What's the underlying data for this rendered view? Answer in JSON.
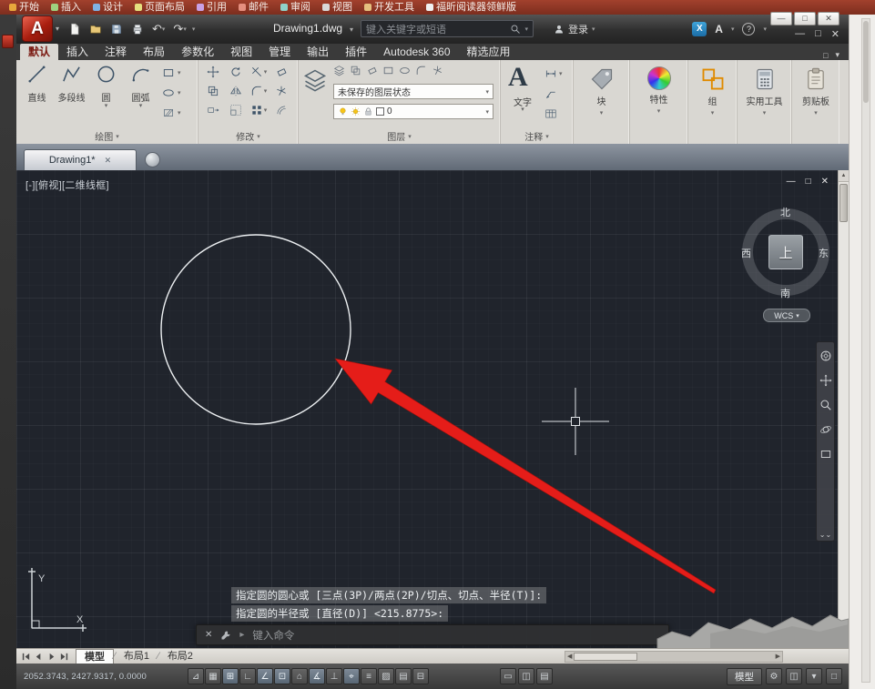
{
  "icons": {
    "minimize": "—",
    "restore": "□",
    "close": "✕",
    "dropdown": "▾",
    "caret": "▸",
    "undo": "↶",
    "redo": "↷",
    "up": "▲",
    "down": "▼",
    "left": "◀",
    "right": "▶",
    "infer": "⊿",
    "snap": "▦",
    "grid": "⊞",
    "ortho": "∟",
    "polar": "∠",
    "osnap": "⊡",
    "osnap3d": "⌂",
    "otrack": "∡",
    "ducs": "⊥",
    "dyn": "⌖",
    "lwt": "≡",
    "transparency": "▨",
    "qp": "▤",
    "cycling": "⊟",
    "slash": "∕",
    "question": "?",
    "exchange": "X",
    "autodesk_a": "A",
    "rect": "▭",
    "split": "◫",
    "gear": "⚙",
    "chevrons": "⌄⌄"
  },
  "outer": {
    "menubar": {
      "items": [
        "开始",
        "插入",
        "设计",
        "页面布局",
        "引用",
        "邮件",
        "审阅",
        "视图",
        "开发工具",
        "福昕阅读器领鲜版"
      ]
    }
  },
  "titlebar": {
    "logo_letter": "A",
    "title": "Drawing1.dwg",
    "search_placeholder": "键入关键字或短语",
    "signin_label": "登录"
  },
  "ribbon": {
    "tabs": [
      {
        "label": "默认"
      },
      {
        "label": "插入"
      },
      {
        "label": "注释"
      },
      {
        "label": "布局"
      },
      {
        "label": "参数化"
      },
      {
        "label": "视图"
      },
      {
        "label": "管理"
      },
      {
        "label": "输出"
      },
      {
        "label": "插件"
      },
      {
        "label": "Autodesk 360"
      },
      {
        "label": "精选应用"
      }
    ],
    "panels": {
      "draw": {
        "title": "绘图",
        "tools": [
          {
            "label": "直线"
          },
          {
            "label": "多段线"
          },
          {
            "label": "圆"
          },
          {
            "label": "圆弧"
          }
        ]
      },
      "modify": {
        "title": "修改"
      },
      "layers": {
        "title": "图层",
        "state_dropdown": "未保存的图层状态",
        "current_layer": "0"
      },
      "annotate": {
        "title": "注释",
        "text_tool": "文字"
      },
      "block": {
        "title": "块"
      },
      "properties": {
        "title": "特性"
      },
      "group": {
        "title": "组"
      },
      "utilities": {
        "title": "实用工具"
      },
      "clipboard": {
        "title": "剪贴板"
      }
    }
  },
  "doc_tabs": {
    "active": "Drawing1*"
  },
  "viewport": {
    "controls_label": "[-][俯视][二维线框]",
    "viewcube": {
      "north": "北",
      "south": "南",
      "east": "东",
      "west": "西",
      "top": "上",
      "wcs": "WCS"
    },
    "ucs": {
      "x_label": "X",
      "y_label": "Y"
    }
  },
  "command": {
    "history_line1": "指定圆的圆心或 [三点(3P)/两点(2P)/切点、切点、半径(T)]:",
    "history_line2": "指定圆的半径或 [直径(D)] <215.8775>:",
    "input_placeholder": "键入命令"
  },
  "layout_tabs": {
    "model": "模型",
    "layout1": "布局1",
    "layout2": "布局2"
  },
  "statusbar": {
    "coordinates": "2052.3743, 2427.9317, 0.0000",
    "model_toggle": "模型"
  }
}
